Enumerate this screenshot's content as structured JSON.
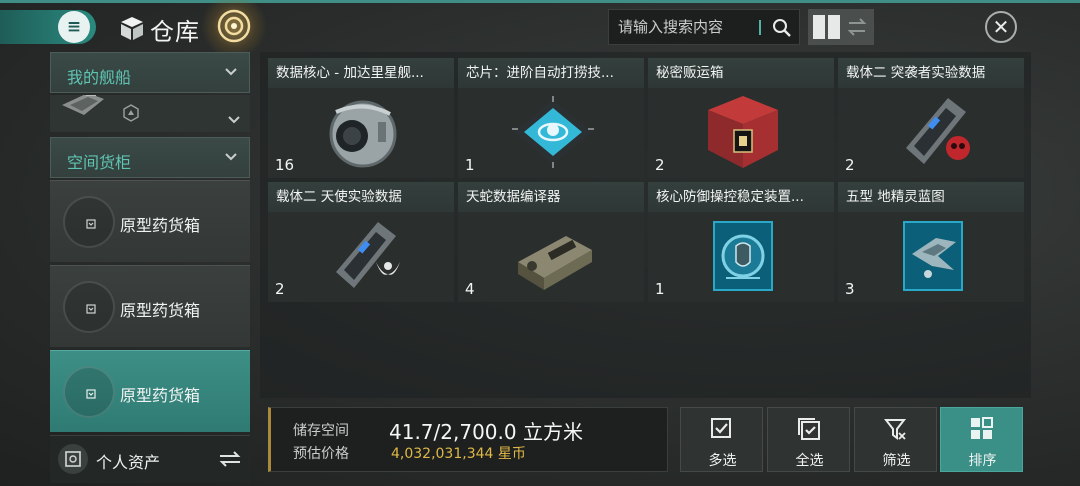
{
  "header": {
    "title": "仓库",
    "menu_icon": "≡",
    "search_placeholder": "请输入搜索内容",
    "close_icon": "✕"
  },
  "sidebar": {
    "my_ships_label": "我的舰船",
    "cargo_label": "空间货柜",
    "boxes": [
      {
        "name": "原型药货箱",
        "active": false
      },
      {
        "name": "原型药货箱",
        "active": false
      },
      {
        "name": "原型药货箱",
        "active": true
      }
    ],
    "assets_label": "个人资产"
  },
  "items": [
    {
      "title": "数据核心 - 加达里星舰...",
      "qty": "16",
      "icon": "data-core-sphere"
    },
    {
      "title": "芯片：进阶自动打捞技...",
      "qty": "1",
      "icon": "chip"
    },
    {
      "title": "秘密贩运箱",
      "qty": "2",
      "icon": "red-crate"
    },
    {
      "title": "载体二 突袭者实验数据",
      "qty": "2",
      "icon": "data-carrier-red-skull"
    },
    {
      "title": "载体二 天使实验数据",
      "qty": "2",
      "icon": "data-carrier-angel"
    },
    {
      "title": "天蛇数据编译器",
      "qty": "4",
      "icon": "data-compiler"
    },
    {
      "title": "核心防御操控稳定装置...",
      "qty": "1",
      "icon": "shield-blueprint"
    },
    {
      "title": "五型 地精灵蓝图",
      "qty": "3",
      "icon": "ship-blueprint"
    }
  ],
  "storage": {
    "space_label": "储存空间",
    "space_value": "41.7/2,700.0 立方米",
    "price_label": "预估价格",
    "price_value": "4,032,031,344 星币"
  },
  "actions": [
    {
      "label": "多选",
      "icon": "multi-select-icon"
    },
    {
      "label": "全选",
      "icon": "select-all-icon"
    },
    {
      "label": "筛选",
      "icon": "filter-icon"
    },
    {
      "label": "排序",
      "icon": "sort-icon"
    }
  ],
  "colors": {
    "accent": "#3a8f86",
    "teal_text": "#5fc4b3",
    "gold": "#e0b846"
  }
}
